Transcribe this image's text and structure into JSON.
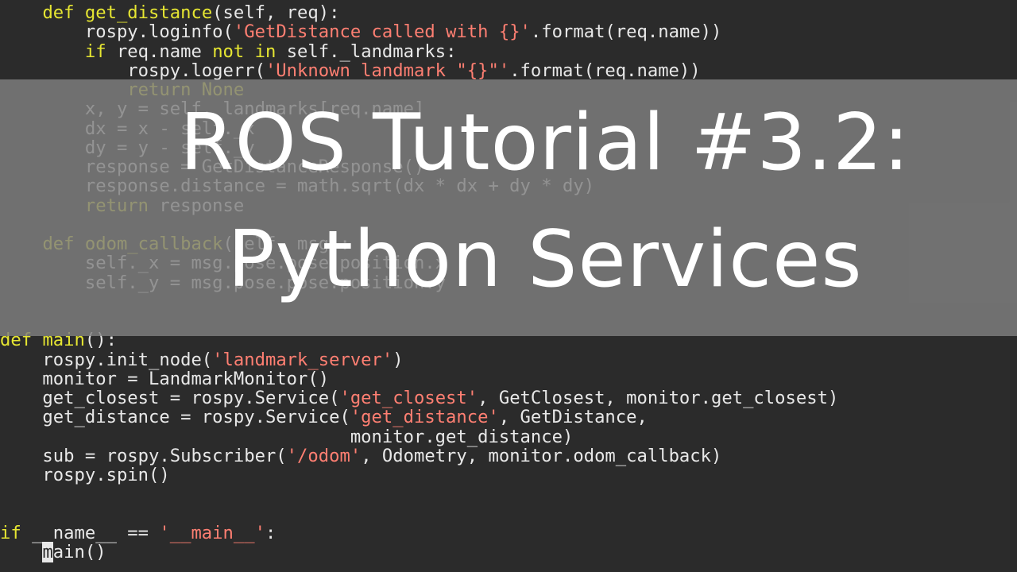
{
  "overlay": {
    "title_line1": "ROS Tutorial #3.2:",
    "title_line2": "Python Services"
  },
  "code_lines": [
    [
      {
        "t": "    "
      },
      {
        "t": "def",
        "c": "kw"
      },
      {
        "t": " "
      },
      {
        "t": "get_distance",
        "c": "fn"
      },
      {
        "t": "(self, req):"
      }
    ],
    [
      {
        "t": "        rospy.loginfo("
      },
      {
        "t": "'GetDistance called with {}'",
        "c": "str"
      },
      {
        "t": ".format(req.name))"
      }
    ],
    [
      {
        "t": "        "
      },
      {
        "t": "if",
        "c": "kw"
      },
      {
        "t": " req.name "
      },
      {
        "t": "not in",
        "c": "kw"
      },
      {
        "t": " self._landmarks:"
      }
    ],
    [
      {
        "t": "            rospy.logerr("
      },
      {
        "t": "'Unknown landmark \"{}\"'",
        "c": "str"
      },
      {
        "t": ".format(req.name))"
      }
    ],
    [
      {
        "t": "            "
      },
      {
        "t": "return None",
        "c": "kw"
      }
    ],
    [
      {
        "t": "        x, y = self._landmarks[req.name]"
      }
    ],
    [
      {
        "t": "        dx = x - self._x"
      }
    ],
    [
      {
        "t": "        dy = y - self._y"
      }
    ],
    [
      {
        "t": "        response = GetDistanceResponse()"
      }
    ],
    [
      {
        "t": "        response.distance = math.sqrt(dx * dx + dy * dy)"
      }
    ],
    [
      {
        "t": "        "
      },
      {
        "t": "return",
        "c": "kw"
      },
      {
        "t": " response"
      }
    ],
    [
      {
        "t": ""
      }
    ],
    [
      {
        "t": "    "
      },
      {
        "t": "def",
        "c": "kw"
      },
      {
        "t": " "
      },
      {
        "t": "odom_callback",
        "c": "fn"
      },
      {
        "t": "(self, msg):"
      }
    ],
    [
      {
        "t": "        self._x = msg.pose.pose.position.x"
      }
    ],
    [
      {
        "t": "        self._y = msg.pose.pose.position.y"
      }
    ],
    [
      {
        "t": ""
      }
    ],
    [
      {
        "t": ""
      }
    ],
    [
      {
        "t": "def",
        "c": "kw"
      },
      {
        "t": " "
      },
      {
        "t": "main",
        "c": "fn"
      },
      {
        "t": "():"
      }
    ],
    [
      {
        "t": "    rospy.init_node("
      },
      {
        "t": "'landmark_server'",
        "c": "str"
      },
      {
        "t": ")"
      }
    ],
    [
      {
        "t": "    monitor = LandmarkMonitor()"
      }
    ],
    [
      {
        "t": "    get_closest = rospy.Service("
      },
      {
        "t": "'get_closest'",
        "c": "str"
      },
      {
        "t": ", GetClosest, monitor.get_closest)"
      }
    ],
    [
      {
        "t": "    get_distance = rospy.Service("
      },
      {
        "t": "'get_distance'",
        "c": "str"
      },
      {
        "t": ", GetDistance,"
      }
    ],
    [
      {
        "t": "                                 monitor.get_distance)"
      }
    ],
    [
      {
        "t": "    sub = rospy.Subscriber("
      },
      {
        "t": "'/odom'",
        "c": "str"
      },
      {
        "t": ", Odometry, monitor.odom_callback)"
      }
    ],
    [
      {
        "t": "    rospy.spin()"
      }
    ],
    [
      {
        "t": ""
      }
    ],
    [
      {
        "t": ""
      }
    ],
    [
      {
        "t": "if",
        "c": "kw"
      },
      {
        "t": " __name__ == "
      },
      {
        "t": "'__main__'",
        "c": "str"
      },
      {
        "t": ":"
      }
    ],
    [
      {
        "t": "    "
      },
      {
        "t": "m",
        "c": "cursor"
      },
      {
        "t": "ain()"
      }
    ]
  ]
}
